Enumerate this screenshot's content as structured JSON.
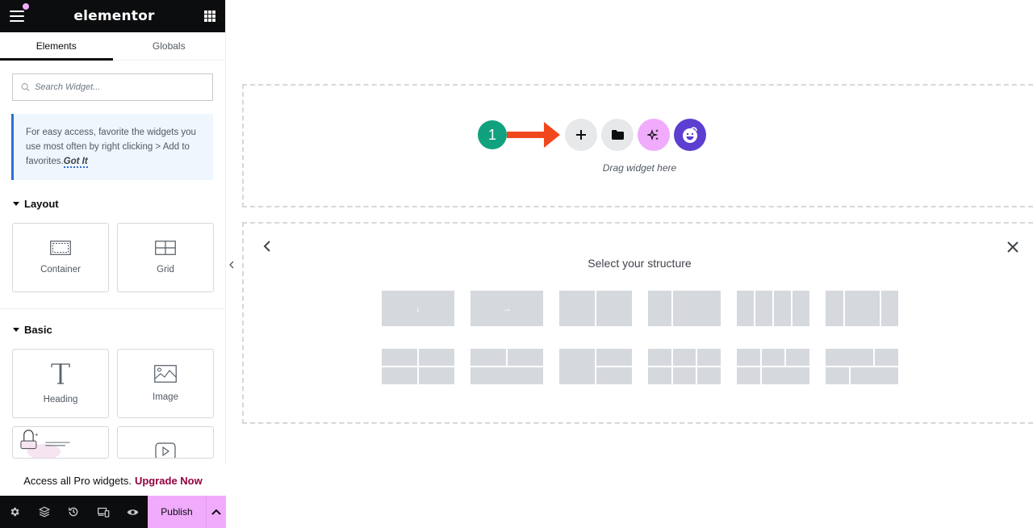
{
  "app": {
    "logo": "elementor",
    "notification_dot_color": "#f0abfc"
  },
  "sidebar": {
    "tabs": [
      {
        "label": "Elements",
        "active": true
      },
      {
        "label": "Globals",
        "active": false
      }
    ],
    "search": {
      "placeholder": "Search Widget...",
      "value": ""
    },
    "tip": {
      "text": "For easy access, favorite the widgets you use most often by right clicking > Add to favorites.",
      "action": "Got It"
    },
    "sections": [
      {
        "title": "Layout",
        "widgets": [
          {
            "label": "Container",
            "icon": "container-icon"
          },
          {
            "label": "Grid",
            "icon": "grid-layout-icon"
          }
        ]
      },
      {
        "title": "Basic",
        "widgets": [
          {
            "label": "Heading",
            "icon": "heading-icon"
          },
          {
            "label": "Image",
            "icon": "image-icon"
          },
          {
            "label": "",
            "icon": "text-editor-icon"
          },
          {
            "label": "",
            "icon": "video-icon"
          }
        ]
      }
    ],
    "pro_bar": {
      "text": "Access all Pro widgets.",
      "link": "Upgrade Now",
      "link_color": "#93003f"
    },
    "footer": {
      "icons": [
        "settings-icon",
        "layers-icon",
        "history-icon",
        "responsive-icon",
        "preview-icon"
      ],
      "publish_label": "Publish",
      "publish_color": "#f0abfc"
    }
  },
  "canvas": {
    "dropzone": {
      "step_number": "1",
      "step_color": "#12a17f",
      "arrow_color": "#f1471d",
      "buttons": [
        "add-section-icon",
        "template-library-icon",
        "ai-icon",
        "emoji-icon"
      ],
      "hint": "Drag widget here"
    },
    "structure": {
      "title": "Select your structure",
      "presets_row1": [
        "flexbox-column",
        "flexbox-row",
        "2 columns",
        "1/3 + 2/3 columns",
        "4 columns",
        "1/4 + 1/2 + 1/4 columns"
      ],
      "presets_row2": [
        "2x2 grid",
        "2 + 1 rows",
        "1 + 2 split",
        "3x2 grid",
        "3 + 2 rows",
        "2 + 2 offset rows"
      ]
    }
  }
}
